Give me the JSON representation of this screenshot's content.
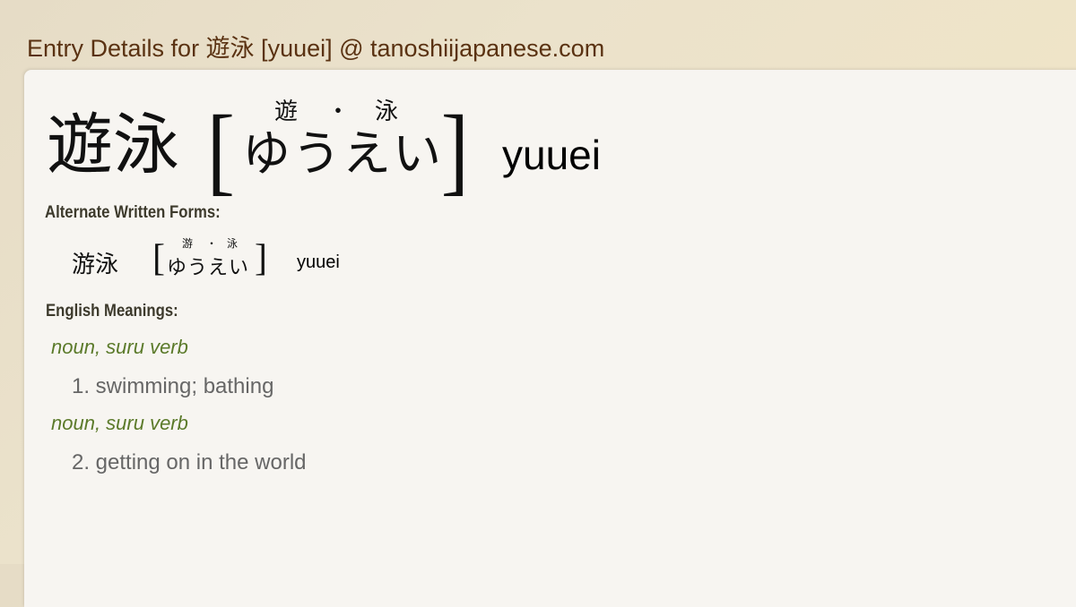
{
  "page": {
    "title": "Entry Details for 遊泳 [yuuei] @ tanoshiijapanese.com"
  },
  "entry": {
    "kanji": "遊泳",
    "bracket_open": "[",
    "bracket_close": "]",
    "reading": "ゆうえい",
    "furigana": [
      "遊",
      "・",
      "泳"
    ],
    "romaji": "yuuei"
  },
  "alternate": {
    "label": "Alternate Written Forms:",
    "kanji": "游泳",
    "bracket_open": "[",
    "bracket_close": "]",
    "reading": "ゆうえい",
    "furigana": [
      "游",
      "・",
      "泳"
    ],
    "romaji": "yuuei"
  },
  "meanings": {
    "label": "English Meanings:",
    "items": [
      {
        "pos": "noun, suru verb",
        "text": "1. swimming; bathing"
      },
      {
        "pos": "noun, suru verb",
        "text": "2. getting on in the world"
      }
    ]
  }
}
